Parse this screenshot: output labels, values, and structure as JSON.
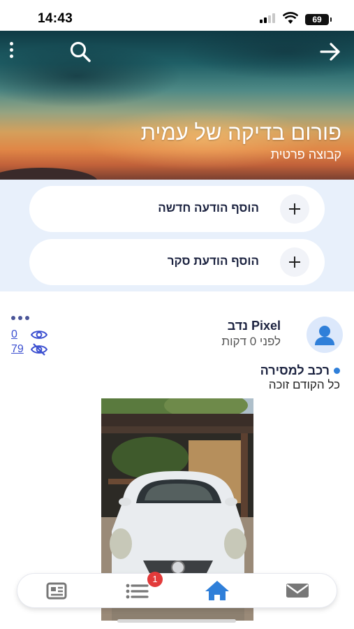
{
  "status_bar": {
    "time": "14:43",
    "battery": "69"
  },
  "header": {
    "title": "פורום בדיקה של עמית",
    "subtitle": "קבוצה פרטית",
    "icons": [
      "more-vertical-icon",
      "search-icon",
      "arrow-right-icon"
    ]
  },
  "actions": {
    "add_post": "הוסף הודעה חדשה",
    "add_poll": "הוסף הודעת סקר"
  },
  "post": {
    "author": "Pixel נדב",
    "time": "לפני 0 דקות",
    "title": "רכב למסירה",
    "body": "כל הקודם זוכה",
    "views": "0",
    "unseen": "79",
    "topic_color": "#2f7fd9"
  },
  "bottom_nav": {
    "badge": "1",
    "items": [
      "newspaper-icon",
      "list-icon",
      "home-icon",
      "mail-icon"
    ],
    "active_color": "#2f7fd9"
  }
}
